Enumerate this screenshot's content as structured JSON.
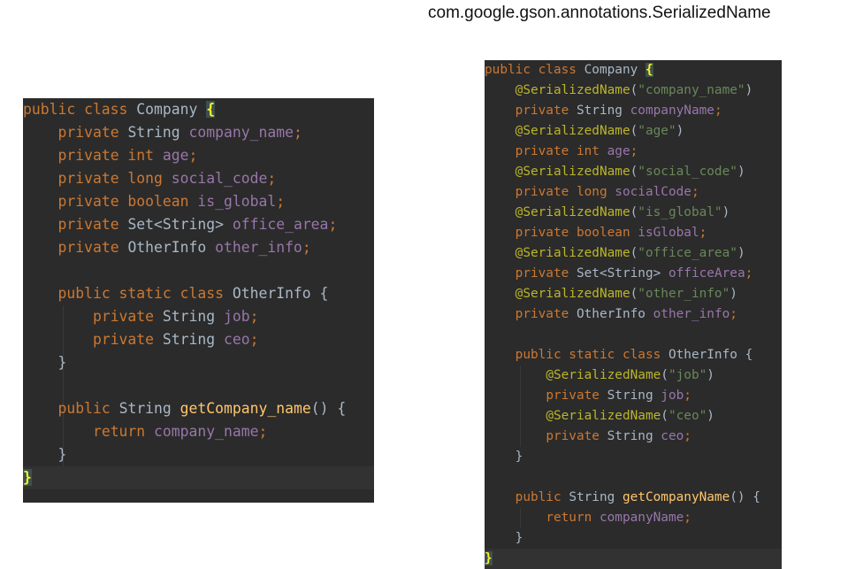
{
  "caption": "com.google.gson.annotations.SerializedName",
  "colors": {
    "editor_background": "#2b2b2b",
    "keyword": "#cc7832",
    "type": "#a9b7c6",
    "field": "#9876aa",
    "annotation": "#bbb529",
    "string": "#6a8759",
    "method": "#ffc66d",
    "brace_highlight": "#ffef28"
  },
  "left_code": {
    "l1": {
      "kw": "public class",
      "name": "Company",
      "brace": "{"
    },
    "l2": {
      "kw": "private",
      "type": "String",
      "field": "company_name",
      "end": ";"
    },
    "l3": {
      "kw": "private int",
      "field": "age",
      "end": ";"
    },
    "l4": {
      "kw": "private long",
      "field": "social_code",
      "end": ";"
    },
    "l5": {
      "kw": "private boolean",
      "field": "is_global",
      "end": ";"
    },
    "l6": {
      "kw": "private",
      "type": "Set<String>",
      "field": "office_area",
      "end": ";"
    },
    "l7": {
      "kw": "private",
      "type": "OtherInfo",
      "field": "other_info",
      "end": ";"
    },
    "l9": {
      "kw": "public static class",
      "name": "OtherInfo",
      "brace": "{"
    },
    "l10": {
      "kw": "private",
      "type": "String",
      "field": "job",
      "end": ";"
    },
    "l11": {
      "kw": "private",
      "type": "String",
      "field": "ceo",
      "end": ";"
    },
    "l12": {
      "brace": "}"
    },
    "l14": {
      "kw": "public",
      "type": "String",
      "method": "getCompany_name",
      "parens": "()",
      "brace": "{"
    },
    "l15": {
      "kw": "return",
      "field": "company_name",
      "end": ";"
    },
    "l16": {
      "brace": "}"
    },
    "l17": {
      "brace": "}"
    }
  },
  "right_code": {
    "l1": {
      "kw": "public class",
      "name": "Company",
      "brace": "{"
    },
    "l2": {
      "ann": "@SerializedName",
      "open": "(",
      "str": "\"company_name\"",
      "close": ")"
    },
    "l3": {
      "kw": "private",
      "type": "String",
      "field": "companyName",
      "end": ";"
    },
    "l4": {
      "ann": "@SerializedName",
      "open": "(",
      "str": "\"age\"",
      "close": ")"
    },
    "l5": {
      "kw": "private int",
      "field": "age",
      "end": ";"
    },
    "l6": {
      "ann": "@SerializedName",
      "open": "(",
      "str": "\"social_code\"",
      "close": ")"
    },
    "l7": {
      "kw": "private long",
      "field": "socialCode",
      "end": ";"
    },
    "l8": {
      "ann": "@SerializedName",
      "open": "(",
      "str": "\"is_global\"",
      "close": ")"
    },
    "l9": {
      "kw": "private boolean",
      "field": "isGlobal",
      "end": ";"
    },
    "l10": {
      "ann": "@SerializedName",
      "open": "(",
      "str": "\"office_area\"",
      "close": ")"
    },
    "l11": {
      "kw": "private",
      "type": "Set<String>",
      "field": "officeArea",
      "end": ";"
    },
    "l12": {
      "ann": "@SerializedName",
      "open": "(",
      "str": "\"other_info\"",
      "close": ")"
    },
    "l13": {
      "kw": "private",
      "type": "OtherInfo",
      "field": "other_info",
      "end": ";"
    },
    "l15": {
      "kw": "public static class",
      "name": "OtherInfo",
      "brace": "{"
    },
    "l16": {
      "ann": "@SerializedName",
      "open": "(",
      "str": "\"job\"",
      "close": ")"
    },
    "l17": {
      "kw": "private",
      "type": "String",
      "field": "job",
      "end": ";"
    },
    "l18": {
      "ann": "@SerializedName",
      "open": "(",
      "str": "\"ceo\"",
      "close": ")"
    },
    "l19": {
      "kw": "private",
      "type": "String",
      "field": "ceo",
      "end": ";"
    },
    "l20": {
      "brace": "}"
    },
    "l22": {
      "kw": "public",
      "type": "String",
      "method": "getCompanyName",
      "parens": "()",
      "brace": "{"
    },
    "l23": {
      "kw": "return",
      "field": "companyName",
      "end": ";"
    },
    "l24": {
      "brace": "}"
    },
    "l25": {
      "brace": "}"
    }
  }
}
